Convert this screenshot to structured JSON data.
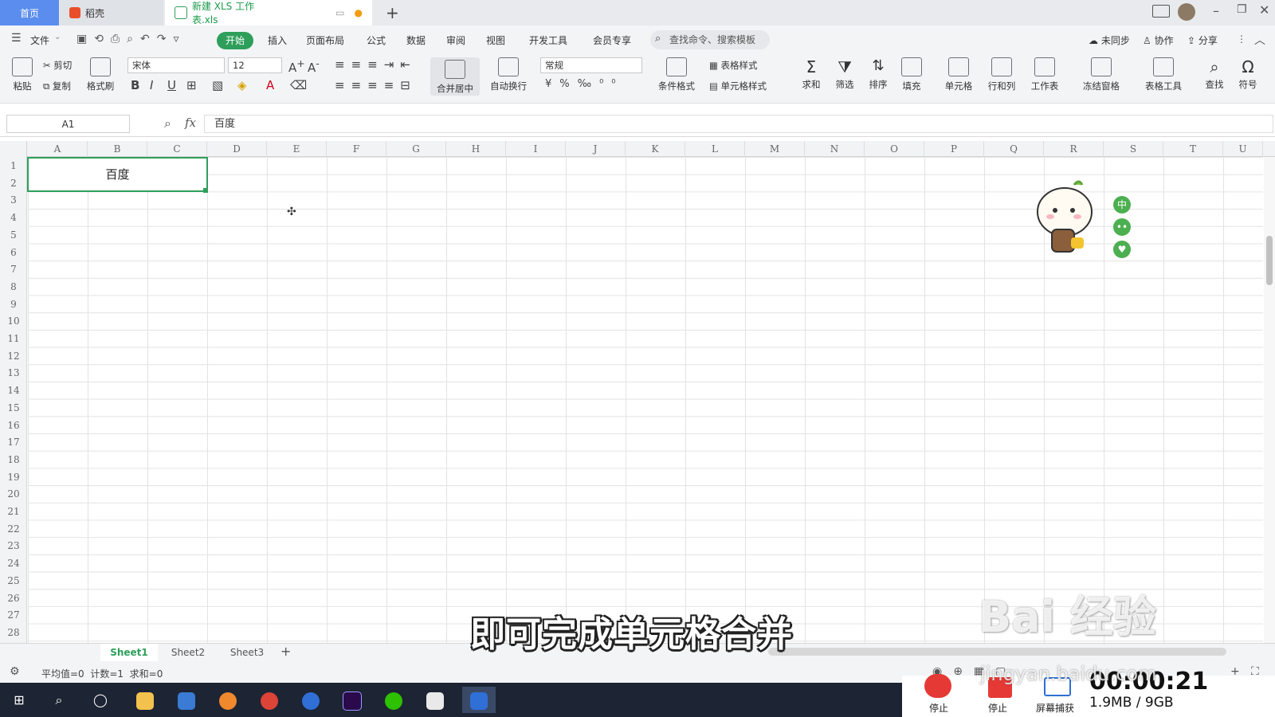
{
  "tabs": {
    "home": "首页",
    "daoke": "稻壳",
    "file": "新建 XLS 工作表.xls",
    "add": "+"
  },
  "menu": {
    "file": "文件",
    "items": [
      "开始",
      "插入",
      "页面布局",
      "公式",
      "数据",
      "审阅",
      "视图",
      "开发工具",
      "会员专享"
    ],
    "search_placeholder": "查找命令、搜索模板",
    "unsynced": "未同步",
    "collab": "协作",
    "share": "分享"
  },
  "ribbon": {
    "paste": "粘贴",
    "cut": "剪切",
    "copy": "复制",
    "format_painter": "格式刷",
    "font_name": "宋体",
    "font_size": "12",
    "merge_center": "合并居中",
    "auto_wrap": "自动换行",
    "number_format": "常规",
    "cond_format": "条件格式",
    "table_style": "表格样式",
    "cell_style": "单元格样式",
    "sum": "求和",
    "filter": "筛选",
    "sort": "排序",
    "fill": "填充",
    "cell": "单元格",
    "row_col": "行和列",
    "worksheet": "工作表",
    "freeze": "冻结窗格",
    "table_tools": "表格工具",
    "find": "查找",
    "symbol": "符号"
  },
  "formula_bar": {
    "name_box": "A1",
    "fx": "fx",
    "content": "百度"
  },
  "grid": {
    "columns": [
      "A",
      "B",
      "C",
      "D",
      "E",
      "F",
      "G",
      "H",
      "I",
      "J",
      "K",
      "L",
      "M",
      "N",
      "O",
      "P",
      "Q",
      "R",
      "S",
      "T",
      "U"
    ],
    "rows": [
      "1",
      "2",
      "3",
      "4",
      "5",
      "6",
      "7",
      "8",
      "9",
      "10",
      "11",
      "12",
      "13",
      "14",
      "15",
      "16",
      "17",
      "18",
      "19",
      "20",
      "21",
      "22",
      "23",
      "24",
      "25",
      "26",
      "27",
      "28"
    ],
    "merged_cell_value": "百度"
  },
  "sheets": [
    "Sheet1",
    "Sheet2",
    "Sheet3"
  ],
  "status": {
    "summary": "平均值=0  计数=1  求和=0"
  },
  "overlay": {
    "subtitle": "即可完成单元格合并",
    "watermark": "Bai 经验",
    "watermark_url": "jingyan.baidu.com",
    "timer": "00:00:21",
    "memory": "1.9MB / 9GB",
    "stop1": "停止",
    "stop2": "停止",
    "capture": "屏幕捕获"
  },
  "colors": {
    "accent": "#2e9f5b",
    "taskbar": "#1d2433"
  }
}
